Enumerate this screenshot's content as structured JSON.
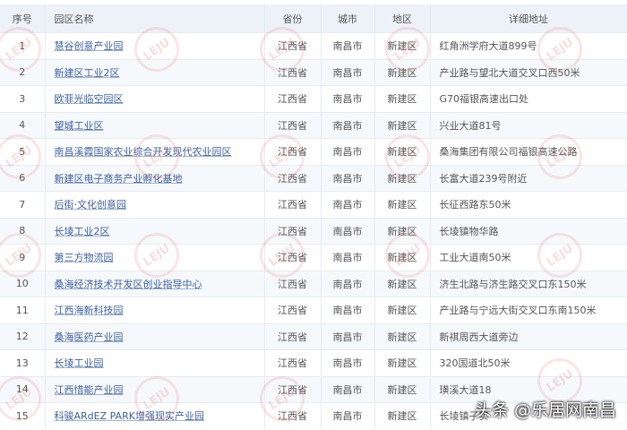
{
  "table": {
    "headers": [
      "序号",
      "园区名称",
      "省份",
      "城市",
      "地区",
      "详细地址"
    ],
    "rows": [
      {
        "no": "1",
        "name": "慧谷创意产业园",
        "province": "江西省",
        "city": "南昌市",
        "district": "新建区",
        "address": "红角洲学府大道899号"
      },
      {
        "no": "2",
        "name": "新建区工业2区",
        "province": "江西省",
        "city": "南昌市",
        "district": "新建区",
        "address": "产业路与望北大道交叉口西50米"
      },
      {
        "no": "3",
        "name": "欧菲光临空园区",
        "province": "江西省",
        "city": "南昌市",
        "district": "新建区",
        "address": "G70福银高速出口处"
      },
      {
        "no": "4",
        "name": "望城工业区",
        "province": "江西省",
        "city": "南昌市",
        "district": "新建区",
        "address": "兴业大道81号"
      },
      {
        "no": "5",
        "name": "南昌溪霞国家农业综合开发现代农业园区",
        "province": "江西省",
        "city": "南昌市",
        "district": "新建区",
        "address": "桑海集团有限公司福银高速公路"
      },
      {
        "no": "6",
        "name": "新建区电子商务产业孵化基地",
        "province": "江西省",
        "city": "南昌市",
        "district": "新建区",
        "address": "长富大道239号附近"
      },
      {
        "no": "7",
        "name": "后街·文化创意园",
        "province": "江西省",
        "city": "南昌市",
        "district": "新建区",
        "address": "长征西路东50米"
      },
      {
        "no": "8",
        "name": "长堎工业2区",
        "province": "江西省",
        "city": "南昌市",
        "district": "新建区",
        "address": "长堎镇物华路"
      },
      {
        "no": "9",
        "name": "第三方物流园",
        "province": "江西省",
        "city": "南昌市",
        "district": "新建区",
        "address": "工业大道南50米"
      },
      {
        "no": "10",
        "name": "桑海经济技术开发区创业指导中心",
        "province": "江西省",
        "city": "南昌市",
        "district": "新建区",
        "address": "济生北路与济生路交叉口东150米"
      },
      {
        "no": "11",
        "name": "江西海新科技园",
        "province": "江西省",
        "city": "南昌市",
        "district": "新建区",
        "address": "产业路与宁远大街交叉口东南150米"
      },
      {
        "no": "12",
        "name": "桑海医药产业园",
        "province": "江西省",
        "city": "南昌市",
        "district": "新建区",
        "address": "新祺周西大道旁边"
      },
      {
        "no": "13",
        "name": "长堎工业园",
        "province": "江西省",
        "city": "南昌市",
        "district": "新建区",
        "address": "320国道北50米"
      },
      {
        "no": "14",
        "name": "江西惜能产业园",
        "province": "江西省",
        "city": "南昌市",
        "district": "新建区",
        "address": "璜溪大道18"
      },
      {
        "no": "15",
        "name": "科骏ARdEZ PARK增强现实产业园",
        "province": "江西省",
        "city": "南昌市",
        "district": "新建区",
        "address": "长堎镇子实"
      }
    ]
  },
  "watermark": {
    "logo": "LEJU 乐居",
    "credit": "头条 @乐居网南昌"
  }
}
